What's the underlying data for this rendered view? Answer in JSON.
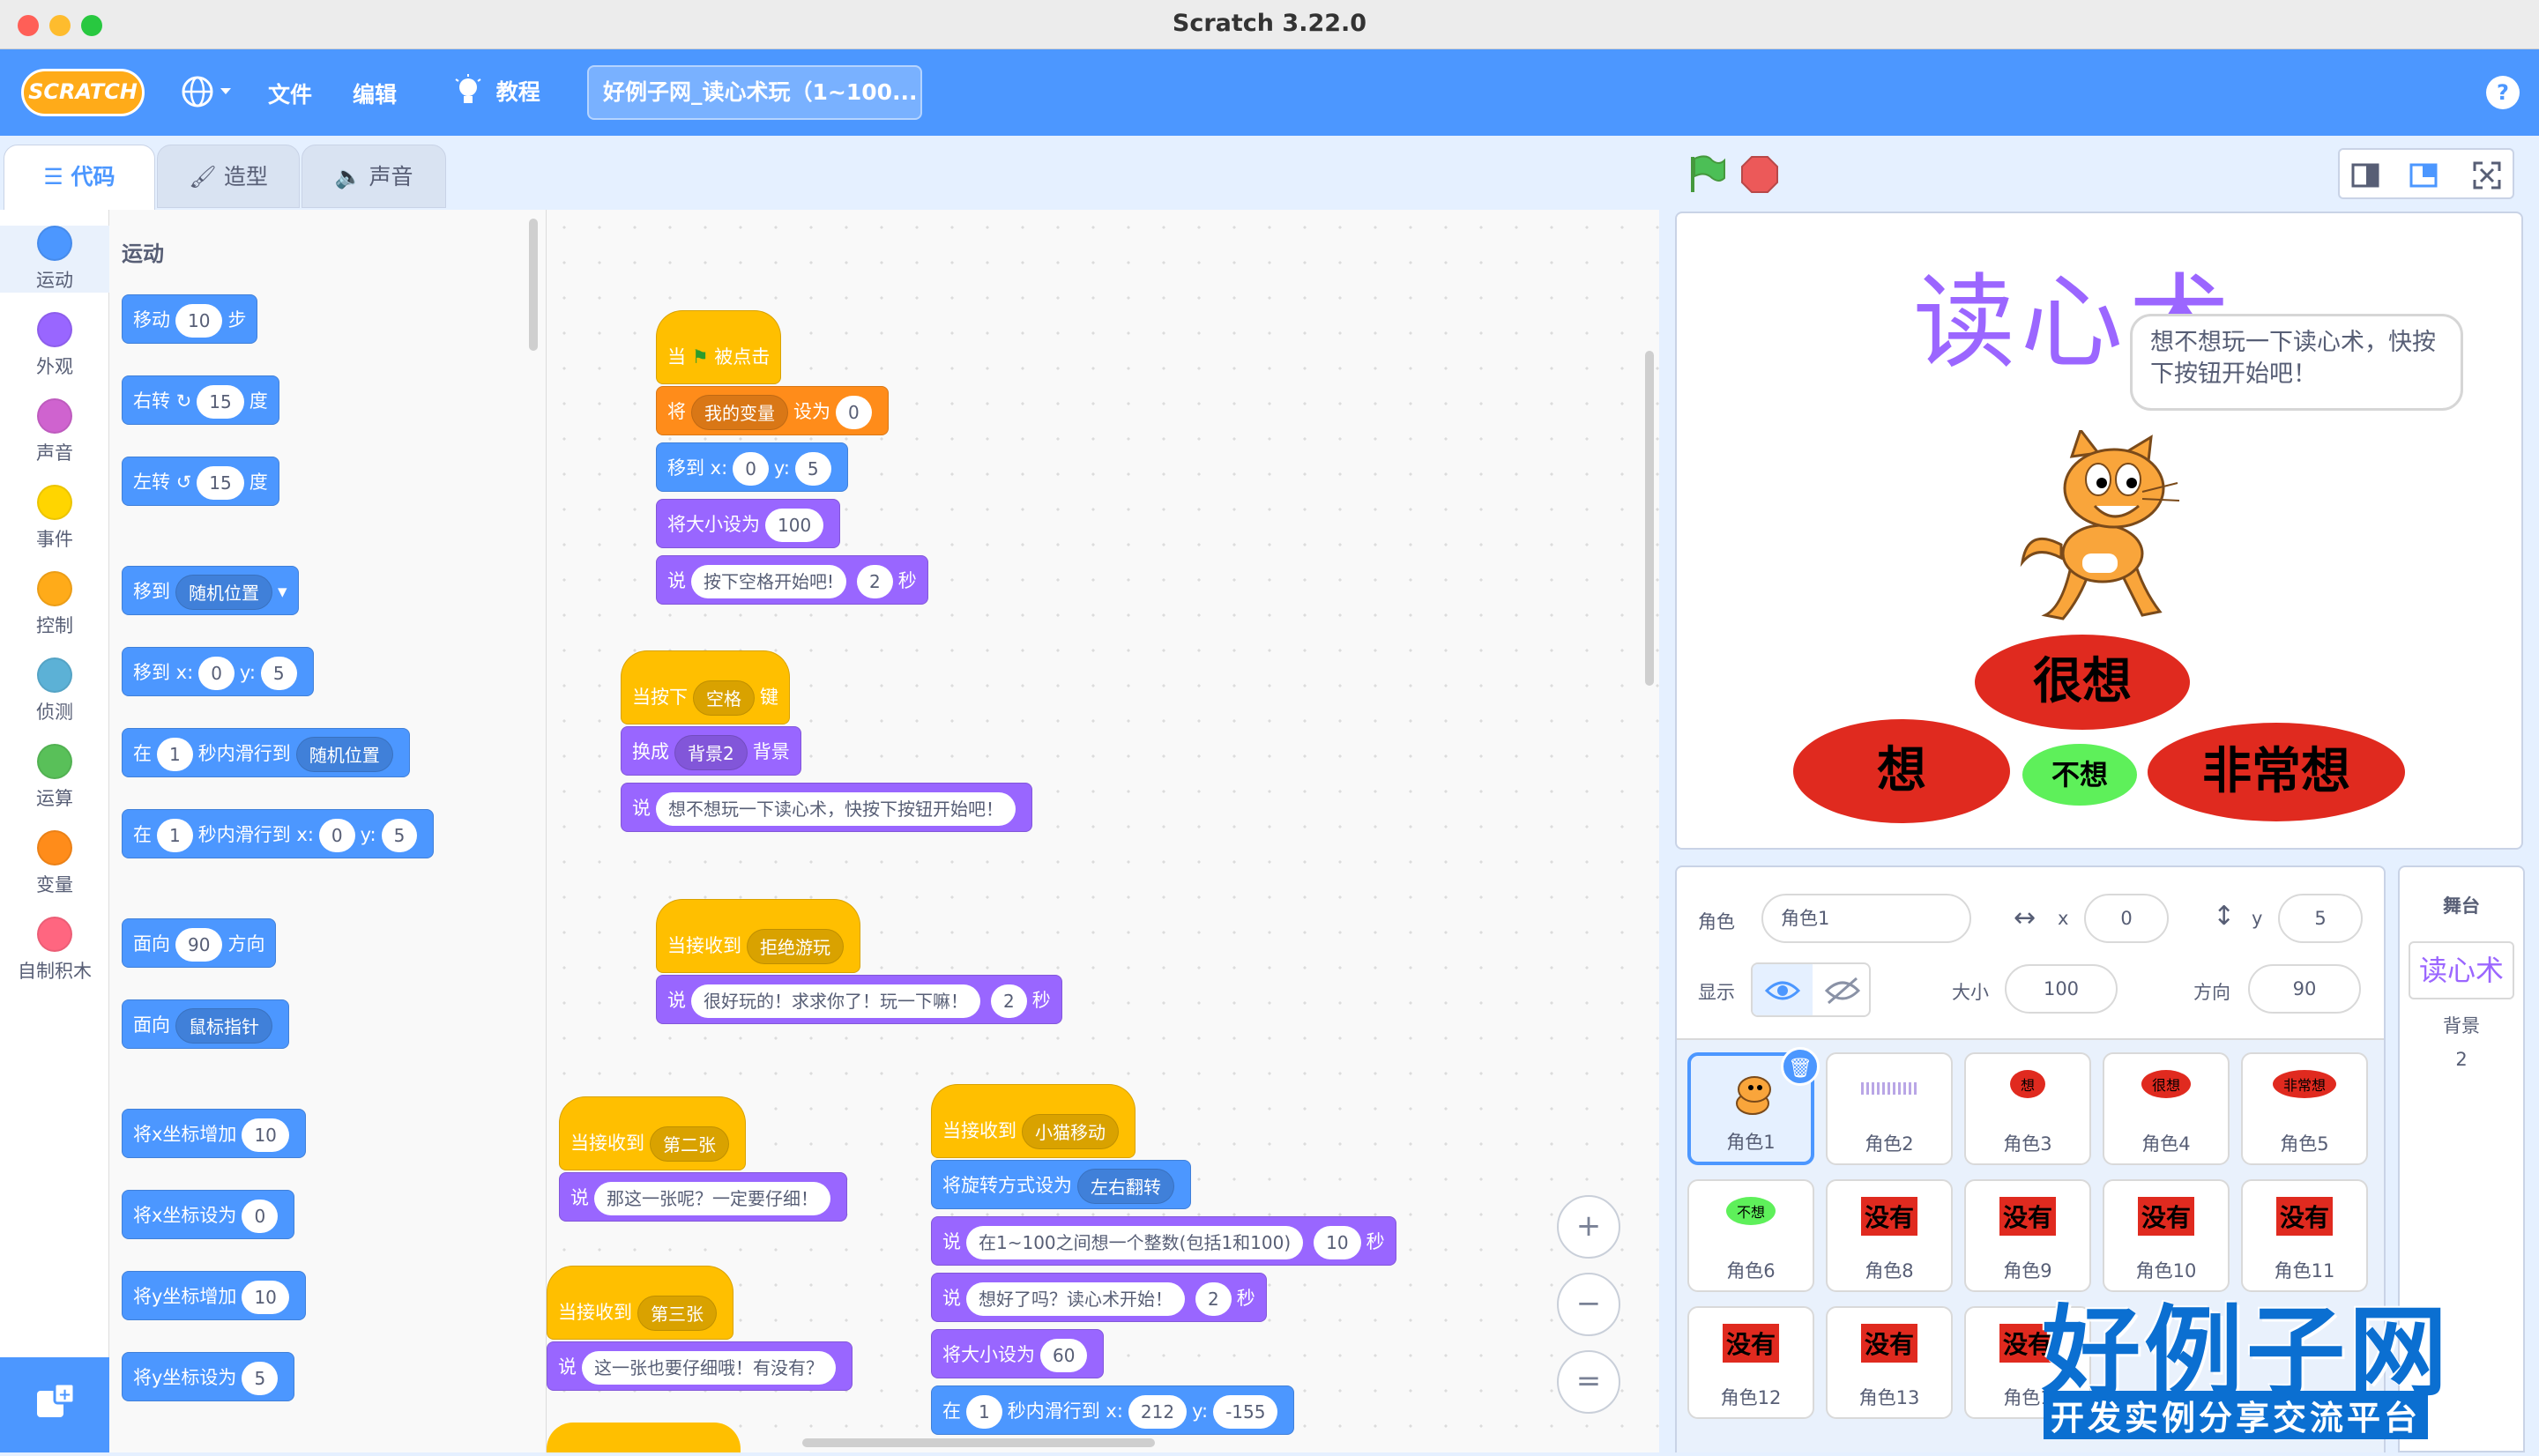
{
  "app": {
    "title": "Scratch 3.22.0"
  },
  "menu": {
    "logo": "SCRATCH",
    "globe": "",
    "file": "文件",
    "edit": "编辑",
    "tutorials": "教程",
    "project_title": "好例子网_读心术玩（1~100...",
    "help": "?"
  },
  "tabs": {
    "code": "代码",
    "costumes": "造型",
    "sounds": "声音"
  },
  "categories": [
    {
      "label": "运动",
      "color": "#4c97ff"
    },
    {
      "label": "外观",
      "color": "#9966ff"
    },
    {
      "label": "声音",
      "color": "#cf63cf"
    },
    {
      "label": "事件",
      "color": "#ffd500"
    },
    {
      "label": "控制",
      "color": "#ffab19"
    },
    {
      "label": "侦测",
      "color": "#5cb1d6"
    },
    {
      "label": "运算",
      "color": "#59c059"
    },
    {
      "label": "变量",
      "color": "#ff8c1a"
    },
    {
      "label": "自制积木",
      "color": "#ff6680"
    }
  ],
  "palette": {
    "heading": "运动",
    "move": {
      "a": "移动",
      "v": "10",
      "b": "步"
    },
    "turn_right": {
      "a": "右转",
      "icon": "↻",
      "v": "15",
      "b": "度"
    },
    "turn_left": {
      "a": "左转",
      "icon": "↺",
      "v": "15",
      "b": "度"
    },
    "goto": {
      "a": "移到",
      "dd": "随机位置"
    },
    "goto_xy": {
      "a": "移到 x:",
      "x": "0",
      "b": "y:",
      "y": "5"
    },
    "glide": {
      "a": "在",
      "v": "1",
      "b": "秒内滑行到",
      "dd": "随机位置"
    },
    "glide_xy": {
      "a": "在",
      "v": "1",
      "b": "秒内滑行到 x:",
      "x": "0",
      "c": "y:",
      "y": "5"
    },
    "point": {
      "a": "面向",
      "v": "90",
      "b": "方向"
    },
    "point_towards": {
      "a": "面向",
      "dd": "鼠标指针"
    },
    "change_x": {
      "a": "将x坐标增加",
      "v": "10"
    },
    "set_x": {
      "a": "将x坐标设为",
      "v": "0"
    },
    "change_y": {
      "a": "将y坐标增加",
      "v": "10"
    },
    "set_y": {
      "a": "将y坐标设为",
      "v": "5"
    }
  },
  "scripts": {
    "s1": {
      "hat": {
        "a": "当",
        "b": "被点击"
      },
      "set_var": {
        "a": "将",
        "dd": "我的变量",
        "b": "设为",
        "v": "0"
      },
      "goto": {
        "a": "移到 x:",
        "x": "0",
        "b": "y:",
        "y": "5"
      },
      "size": {
        "a": "将大小设为",
        "v": "100"
      },
      "say": {
        "a": "说",
        "text": "按下空格开始吧!",
        "v": "2",
        "b": "秒"
      }
    },
    "s2": {
      "hat": {
        "a": "当按下",
        "dd": "空格",
        "b": "键"
      },
      "backdrop": {
        "a": "换成",
        "dd": "背景2",
        "b": "背景"
      },
      "say": {
        "a": "说",
        "text": "想不想玩一下读心术，快按下按钮开始吧！"
      }
    },
    "s3": {
      "hat": {
        "a": "当接收到",
        "dd": "拒绝游玩"
      },
      "say": {
        "a": "说",
        "text": "很好玩的！求求你了！玩一下嘛！",
        "v": "2",
        "b": "秒"
      }
    },
    "s4": {
      "hat": {
        "a": "当接收到",
        "dd": "第二张"
      },
      "say": {
        "a": "说",
        "text": "那这一张呢？一定要仔细！"
      }
    },
    "s5": {
      "hat": {
        "a": "当接收到",
        "dd": "第三张"
      },
      "say": {
        "a": "说",
        "text": "这一张也要仔细哦！有没有？"
      }
    },
    "s6": {
      "hat": {
        "a": "当接收到",
        "dd": "小猫移动"
      },
      "rotation": {
        "a": "将旋转方式设为",
        "dd": "左右翻转"
      },
      "say1": {
        "a": "说",
        "text": "在1~100之间想一个整数(包括1和100)",
        "v": "10",
        "b": "秒"
      },
      "say2": {
        "a": "说",
        "text": "想好了吗？读心术开始！",
        "v": "2",
        "b": "秒"
      },
      "size": {
        "a": "将大小设为",
        "v": "60"
      },
      "glide": {
        "a": "在",
        "v": "1",
        "b": "秒内滑行到 x:",
        "x": "212",
        "c": "y:",
        "y": "-155"
      }
    }
  },
  "zoom": {
    "in": "+",
    "out": "−",
    "reset": "="
  },
  "stage": {
    "title": "读心术",
    "bubble": "想不想玩一下读心术，快按下按钮开始吧！",
    "btn_very": "很想",
    "btn_want": "想",
    "btn_not": "不想",
    "btn_extreme": "非常想"
  },
  "sprite_info": {
    "sprite_label": "角色",
    "sprite_name": "角色1",
    "x_label": "x",
    "x": "0",
    "y_label": "y",
    "y": "5",
    "show_label": "显示",
    "size_label": "大小",
    "size": "100",
    "dir_label": "方向",
    "dir": "90"
  },
  "sprites": [
    {
      "name": "角色1",
      "thumb": ""
    },
    {
      "name": "角色2",
      "thumb": ""
    },
    {
      "name": "角色3",
      "thumb": "想"
    },
    {
      "name": "角色4",
      "thumb": "很想"
    },
    {
      "name": "角色5",
      "thumb": "非常想"
    },
    {
      "name": "角色6",
      "thumb": "不想"
    },
    {
      "name": "角色8",
      "thumb": "没有"
    },
    {
      "name": "角色9",
      "thumb": "没有"
    },
    {
      "name": "角色10",
      "thumb": "没有"
    },
    {
      "name": "角色11",
      "thumb": "没有"
    },
    {
      "name": "角色12",
      "thumb": "没有"
    },
    {
      "name": "角色13",
      "thumb": "没有"
    },
    {
      "name": "角色1",
      "thumb": "没有"
    }
  ],
  "stage_panel": {
    "label": "舞台",
    "thumb": "读心术",
    "backdrops_label": "背景",
    "backdrops": "2"
  },
  "watermark": {
    "big": "好例子网",
    "small": "开发实例分享交流平台"
  }
}
